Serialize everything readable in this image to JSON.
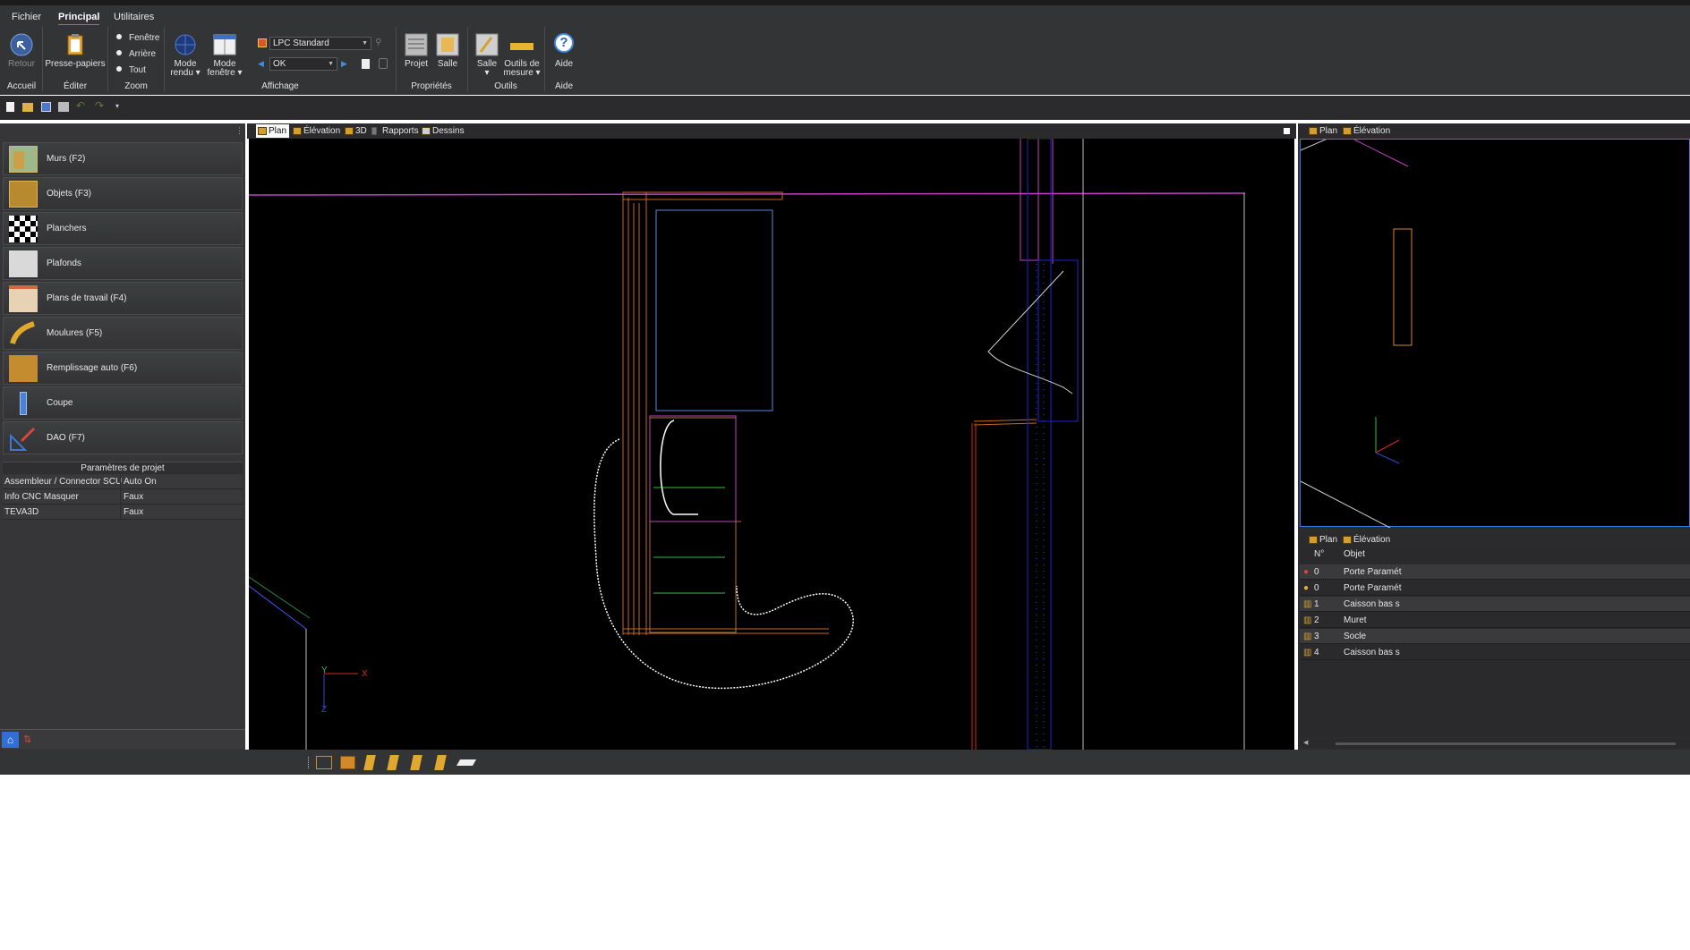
{
  "menu": {
    "items": [
      "Fichier",
      "Principal",
      "Utilitaires"
    ],
    "active": "Principal"
  },
  "ribbon": {
    "retour": "Retour",
    "presse_papiers": "Presse-papiers",
    "zoom_options": [
      "Fenêtre",
      "Arrière",
      "Tout"
    ],
    "mode_rendu": [
      "Mode",
      "rendu ▾"
    ],
    "mode_fenetre": [
      "Mode",
      "fenêtre ▾"
    ],
    "style_combo": "LPC Standard",
    "ok_combo": "OK",
    "projet": "Projet",
    "salle_prop": "Salle",
    "salle_outil": [
      "Salle",
      "▾"
    ],
    "outils_mesure": [
      "Outils de",
      "mesure ▾"
    ],
    "aide": "Aide",
    "groups": {
      "accueil": "Accueil",
      "editer": "Éditer",
      "zoom": "Zoom",
      "affichage": "Affichage",
      "proprietes": "Propriétés",
      "outils": "Outils",
      "aide": "Aide"
    }
  },
  "sidebar": {
    "items": [
      {
        "label": "Murs (F2)",
        "icon": "wall-icon"
      },
      {
        "label": "Objets (F3)",
        "icon": "objects-icon"
      },
      {
        "label": "Planchers",
        "icon": "floor-checker-icon"
      },
      {
        "label": "Plafonds",
        "icon": "ceiling-icon"
      },
      {
        "label": "Plans de travail (F4)",
        "icon": "worktop-icon"
      },
      {
        "label": "Moulures (F5)",
        "icon": "moulding-icon"
      },
      {
        "label": "Remplissage auto (F6)",
        "icon": "autofill-icon"
      },
      {
        "label": "Coupe",
        "icon": "section-icon"
      },
      {
        "label": "DAO (F7)",
        "icon": "cad-icon"
      }
    ],
    "params_title": "Paramètres de projet",
    "params": [
      {
        "name": "Assembleur / Connector SCU",
        "value": "Auto On"
      },
      {
        "name": "Info CNC Masquer",
        "value": "Faux"
      },
      {
        "name": "TEVA3D",
        "value": "Faux"
      }
    ]
  },
  "view_tabs": [
    "Plan",
    "Élévation",
    "3D",
    "Rapports",
    "Dessins"
  ],
  "right_tabs": [
    "Plan",
    "Élévation"
  ],
  "objects_table": {
    "headers": [
      "N°",
      "Objet"
    ],
    "rows": [
      {
        "n": "0",
        "objet": "Porte Paramét"
      },
      {
        "n": "0",
        "objet": "Porte Paramét"
      },
      {
        "n": "1",
        "objet": "Caisson bas s"
      },
      {
        "n": "2",
        "objet": "Muret"
      },
      {
        "n": "3",
        "objet": "Socle"
      },
      {
        "n": "4",
        "objet": "Caisson bas s"
      }
    ]
  },
  "axis_labels": {
    "x": "X",
    "y": "Y",
    "z": "Z"
  }
}
